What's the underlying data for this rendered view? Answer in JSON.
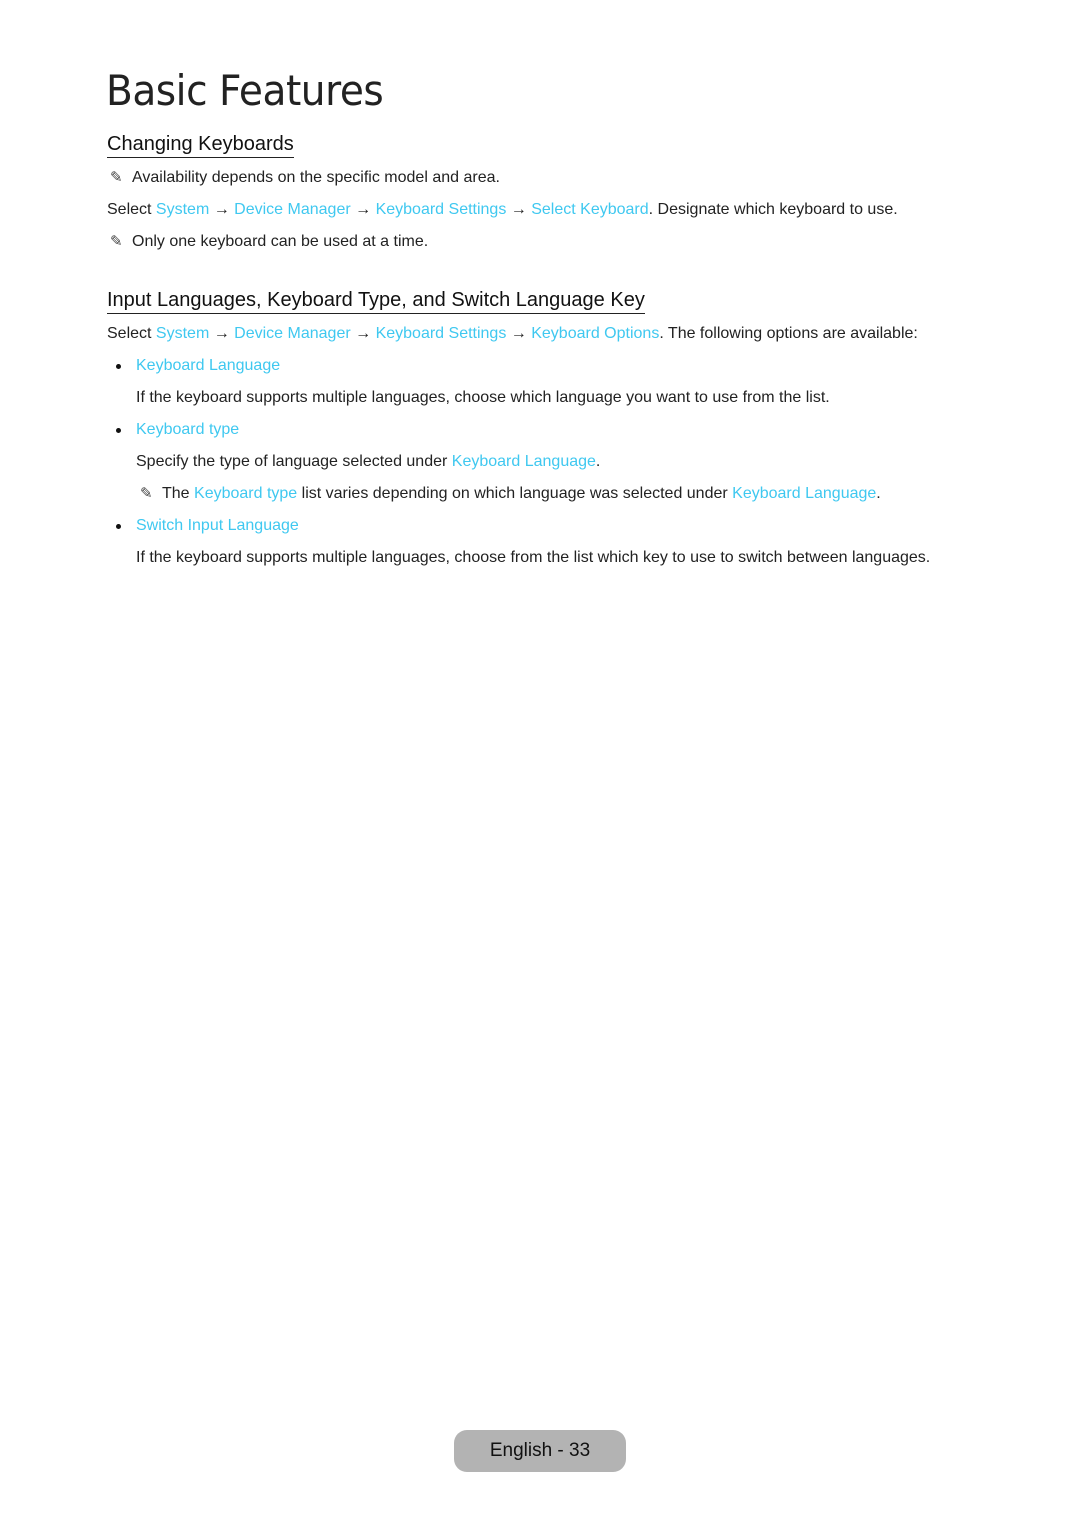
{
  "page": {
    "title": "Basic Features",
    "footer": "English - 33"
  },
  "section1": {
    "heading": "Changing Keyboards",
    "note1": "Availability depends on the specific model and area.",
    "path_prefix": "Select ",
    "path": [
      "System",
      "Device Manager",
      "Keyboard Settings",
      "Select Keyboard"
    ],
    "arrow": "→",
    "path_suffix": ". Designate which keyboard to use.",
    "note2": "Only one keyboard can be used at a time."
  },
  "section2": {
    "heading": "Input Languages, Keyboard Type, and Switch Language Key",
    "path_prefix": "Select ",
    "path": [
      "System",
      "Device Manager",
      "Keyboard Settings",
      "Keyboard Options"
    ],
    "arrow": "→",
    "path_suffix": ". The following options are available:",
    "items": [
      {
        "label": "Keyboard Language",
        "desc": "If the keyboard supports multiple languages, choose which language you want to use from the list."
      },
      {
        "label": "Keyboard type",
        "desc_prefix": "Specify the type of language selected under ",
        "desc_link": "Keyboard Language",
        "desc_suffix": ".",
        "note_prefix": "The ",
        "note_link1": "Keyboard type",
        "note_mid": " list varies depending on which language was selected under ",
        "note_link2": "Keyboard Language",
        "note_suffix": "."
      },
      {
        "label": "Switch Input Language",
        "desc": "If the keyboard supports multiple languages, choose from the list which key to use to switch between languages."
      }
    ]
  },
  "icons": {
    "note": "✎"
  }
}
